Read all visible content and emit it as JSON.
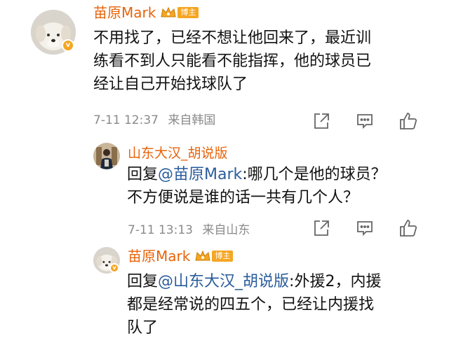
{
  "comment1": {
    "user": "苗原Mark",
    "badge": "博主",
    "lines": [
      "不用找了，已经不想让他回来了，最近训",
      "练看不到人只能看不能指挥，他的球员已",
      "经让自己开始找球队了"
    ],
    "time": "7-11 12:37",
    "location": "来自韩国"
  },
  "reply1": {
    "user": "山东大汉_胡说版",
    "reply_prefix": "回复",
    "mention": "@苗原Mark",
    "line1_rest": ":哪几个是他的球员？",
    "line2": "不方便说是谁的话一共有几个人？",
    "time": "7-11 13:13",
    "location": "来自山东"
  },
  "reply2": {
    "user": "苗原Mark",
    "badge": "博主",
    "reply_prefix": "回复",
    "mention": "@山东大汉_胡说版",
    "line1_rest": ":外援2，内援",
    "line2": "都是经常说的四五个，已经让内援找",
    "line3": "队了"
  },
  "colors": {
    "name": "#e8630a",
    "mention": "#2a5c9c",
    "meta": "#8a8a8a",
    "badge": "#f5a623"
  },
  "icons": [
    "share-icon",
    "comment-icon",
    "like-icon",
    "verified-badge-icon",
    "crown-icon"
  ]
}
